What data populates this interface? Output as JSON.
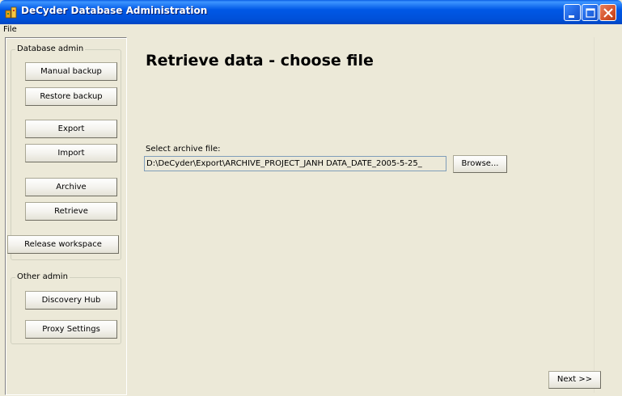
{
  "window": {
    "title": "DeCyder Database Administration"
  },
  "menu": {
    "items": [
      "File"
    ]
  },
  "sidebar": {
    "database_admin": {
      "legend": "Database admin",
      "buttons": {
        "manual_backup": "Manual backup",
        "restore_backup": "Restore backup",
        "export": "Export",
        "import": "Import",
        "archive": "Archive",
        "retrieve": "Retrieve",
        "release_workspace": "Release workspace"
      }
    },
    "other_admin": {
      "legend": "Other admin",
      "buttons": {
        "discovery_hub": "Discovery Hub",
        "proxy_settings": "Proxy Settings"
      }
    }
  },
  "main": {
    "title": "Retrieve data - choose file",
    "archive_label": "Select archive file:",
    "archive_path": "D:\\DeCyder\\Export\\ARCHIVE_PROJECT_JANH DATA_DATE_2005-5-25_",
    "browse_label": "Browse...",
    "next_label": "Next >>"
  },
  "icons": {
    "app": "database-app-icon",
    "minimize": "minimize-icon",
    "maximize": "maximize-icon",
    "close": "close-icon"
  },
  "colors": {
    "titlebar": "#0058e6",
    "window_bg": "#ece9d8",
    "close_button": "#d4532c"
  }
}
